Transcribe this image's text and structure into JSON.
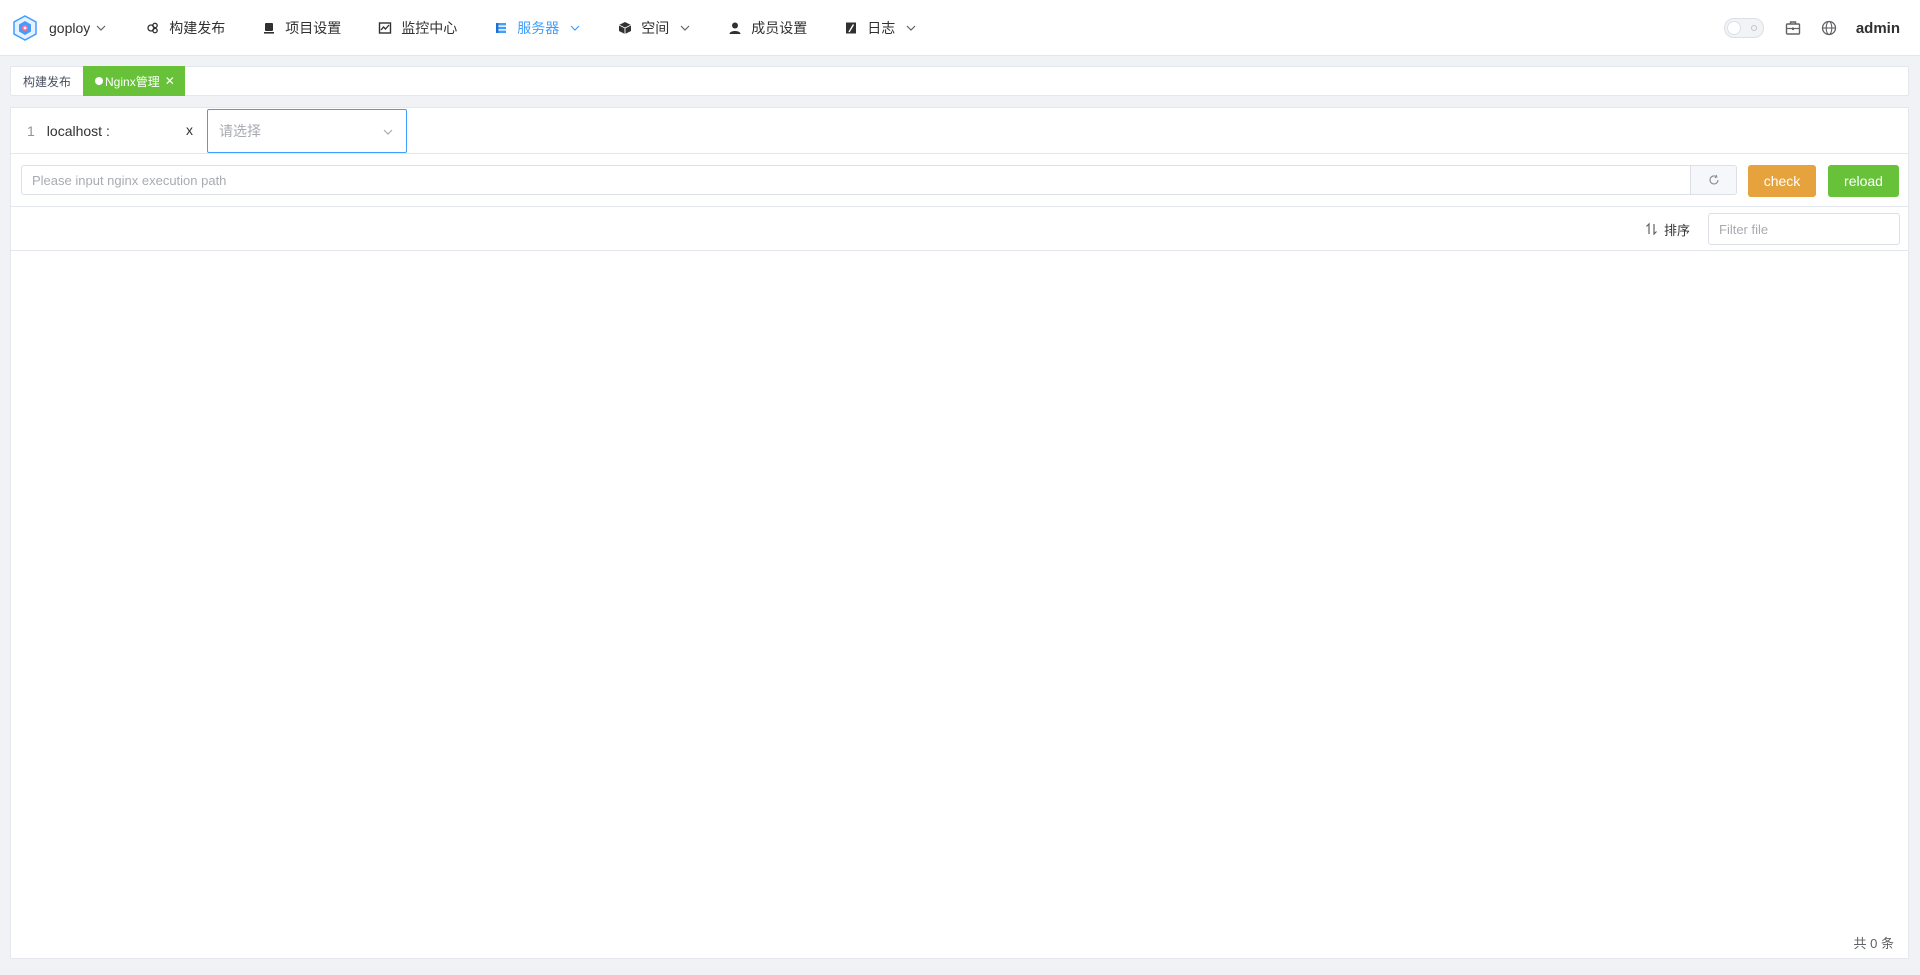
{
  "brand": {
    "name": "goploy"
  },
  "nav": {
    "items": [
      {
        "label": "构建发布",
        "icon": "rocket-icon",
        "has_dropdown": false,
        "active": false
      },
      {
        "label": "项目设置",
        "icon": "project-icon",
        "has_dropdown": false,
        "active": false
      },
      {
        "label": "监控中心",
        "icon": "monitor-icon",
        "has_dropdown": false,
        "active": false
      },
      {
        "label": "服务器",
        "icon": "server-icon",
        "has_dropdown": true,
        "active": true
      },
      {
        "label": "空间",
        "icon": "cube-icon",
        "has_dropdown": true,
        "active": false
      },
      {
        "label": "成员设置",
        "icon": "user-icon",
        "has_dropdown": false,
        "active": false
      },
      {
        "label": "日志",
        "icon": "log-icon",
        "has_dropdown": true,
        "active": false
      }
    ],
    "user_name": "admin"
  },
  "tags": {
    "items": [
      {
        "label": "构建发布",
        "active": false
      },
      {
        "label": "Nginx管理",
        "active": true
      }
    ]
  },
  "server": {
    "id": "1",
    "name": "localhost :",
    "close_label": "x"
  },
  "file_select": {
    "placeholder": "请选择"
  },
  "path": {
    "placeholder": "Please input nginx execution path",
    "value": ""
  },
  "buttons": {
    "check": "check",
    "reload": "reload"
  },
  "toolbar": {
    "sort_label": "排序",
    "filter_placeholder": "Filter file"
  },
  "pagination": {
    "total_text": "共 0 条"
  },
  "colors": {
    "accent": "#409eff",
    "success": "#67c23a",
    "warning": "#e6a23c"
  }
}
